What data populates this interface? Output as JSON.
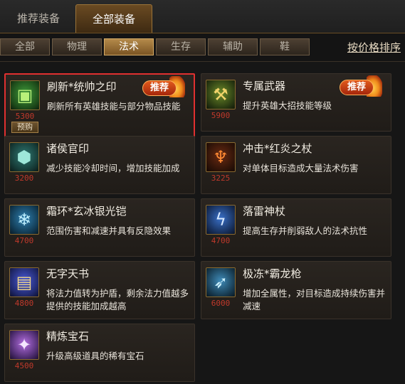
{
  "main_tabs": [
    {
      "label": "推荐装备",
      "active": false
    },
    {
      "label": "全部装备",
      "active": true
    }
  ],
  "sub_tabs": [
    {
      "label": "全部",
      "active": false
    },
    {
      "label": "物理",
      "active": false
    },
    {
      "label": "法术",
      "active": true
    },
    {
      "label": "生存",
      "active": false
    },
    {
      "label": "辅助",
      "active": false
    },
    {
      "label": "鞋",
      "active": false
    }
  ],
  "sort_label": "按价格排序",
  "badge_label": "推荐",
  "preorder_label": "预购",
  "colors": {
    "accent": "#b48a4a",
    "price": "#c0392b",
    "highlight": "#e03030"
  },
  "items": [
    {
      "name": "刷新*统帅之印",
      "desc": "刷新所有英雄技能与部分物品技能",
      "price": "5300",
      "recommended": true,
      "preorder": true,
      "highlighted": true,
      "icon": "green-seal-icon"
    },
    {
      "name": "专属武器",
      "desc": "提升英雄大招技能等级",
      "price": "5900",
      "recommended": true,
      "preorder": false,
      "highlighted": false,
      "icon": "golden-weapon-icon"
    },
    {
      "name": "诸侯官印",
      "desc": "减少技能冷却时间，增加技能加成",
      "price": "3200",
      "recommended": false,
      "preorder": false,
      "highlighted": false,
      "icon": "official-seal-icon"
    },
    {
      "name": "冲击*红炎之杖",
      "desc": "对单体目标造成大量法术伤害",
      "price": "3225",
      "recommended": false,
      "preorder": false,
      "highlighted": false,
      "icon": "flame-staff-icon"
    },
    {
      "name": "霜环*玄冰银光铠",
      "desc": "范围伤害和减速并具有反隐效果",
      "price": "4700",
      "recommended": false,
      "preorder": false,
      "highlighted": false,
      "icon": "ice-armor-icon"
    },
    {
      "name": "落雷神杖",
      "desc": "提高生存并削弱敌人的法术抗性",
      "price": "4700",
      "recommended": false,
      "preorder": false,
      "highlighted": false,
      "icon": "thunder-staff-icon"
    },
    {
      "name": "无字天书",
      "desc": "将法力值转为护盾，剩余法力值越多提供的技能加成越高",
      "price": "4800",
      "recommended": false,
      "preorder": false,
      "highlighted": false,
      "icon": "blank-book-icon"
    },
    {
      "name": "极冻*霸龙枪",
      "desc": "增加全属性，对目标造成持续伤害并减速",
      "price": "6000",
      "recommended": false,
      "preorder": false,
      "highlighted": false,
      "icon": "ice-spear-icon"
    },
    {
      "name": "精炼宝石",
      "desc": "升级高级道具的稀有宝石",
      "price": "4500",
      "recommended": false,
      "preorder": false,
      "highlighted": false,
      "icon": "refined-gem-icon"
    }
  ]
}
